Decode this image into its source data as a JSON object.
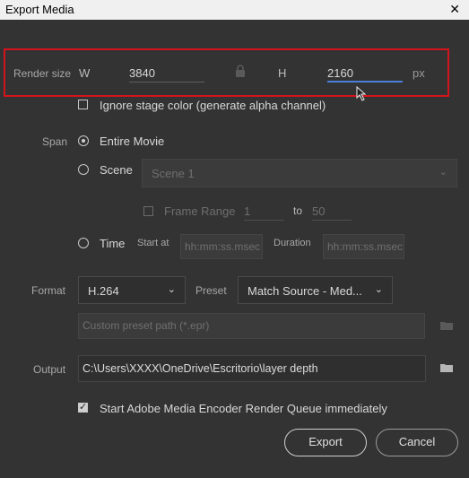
{
  "window": {
    "title": "Export Media",
    "close_icon": "close-icon"
  },
  "render_size": {
    "label": "Render size",
    "width_label": "W",
    "width_value": "3840",
    "height_label": "H",
    "height_value": "2160",
    "unit": "px",
    "lock_icon": "lock-icon"
  },
  "ignore_stage": {
    "label": "Ignore stage color (generate alpha channel)",
    "checked": false
  },
  "span": {
    "label": "Span",
    "entire_movie": "Entire Movie",
    "scene": "Scene",
    "scene_select": "Scene 1",
    "frame_range": "Frame Range",
    "frame_from": "1",
    "frame_to_label": "to",
    "frame_to": "50",
    "time": "Time",
    "start_at_label": "Start at",
    "start_placeholder": "hh:mm:ss.msec",
    "duration_label": "Duration",
    "duration_placeholder": "hh:mm:ss.msec",
    "selected": "Entire Movie"
  },
  "format": {
    "label": "Format",
    "value": "H.264",
    "preset_label": "Preset",
    "preset_value": "Match Source - Med...",
    "custom_preset_placeholder": "Custom preset path (*.epr)"
  },
  "output": {
    "label": "Output",
    "path": "C:\\Users\\XXXX\\OneDrive\\Escritorio\\layer depth"
  },
  "start_encoder": {
    "label": "Start Adobe Media Encoder Render Queue immediately",
    "checked": true
  },
  "buttons": {
    "export": "Export",
    "cancel": "Cancel"
  },
  "colors": {
    "background": "#333333",
    "highlight": "#d4141c",
    "active_underline": "#4a7fd8"
  }
}
